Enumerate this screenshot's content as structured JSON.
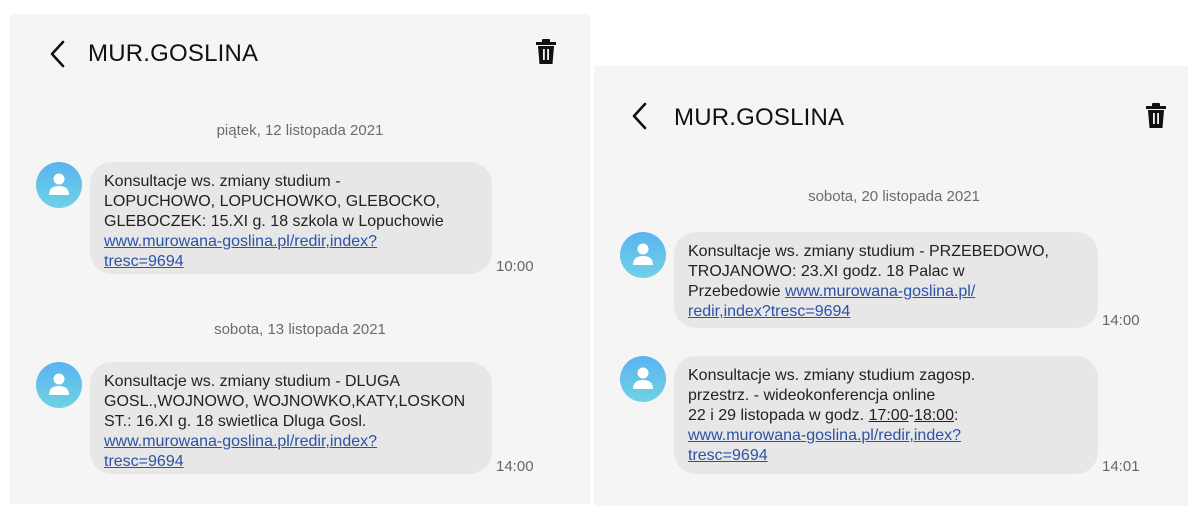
{
  "left": {
    "title": "MUR.GOSLINA",
    "dates": [
      "piątek, 12 listopada 2021",
      "sobota, 13 listopada 2021"
    ],
    "messages": [
      {
        "lines": [
          "Konsultacje ws. zmiany studium -",
          "LOPUCHOWO, LOPUCHOWKO, GLEBOCKO,",
          "GLEBOCZEK: 15.XI g. 18 szkola w Lopuchowie"
        ],
        "link_lines": [
          "www.murowana-goslina.pl/redir,index?",
          "tresc=9694"
        ],
        "time": "10:00"
      },
      {
        "lines": [
          "Konsultacje ws. zmiany studium - DLUGA",
          "GOSL.,WOJNOWO, WOJNOWKO,KATY,LOSKON",
          "ST.: 16.XI g. 18 swietlica Dluga Gosl."
        ],
        "link_lines": [
          "www.murowana-goslina.pl/redir,index?",
          "tresc=9694"
        ],
        "time": "14:00"
      }
    ]
  },
  "right": {
    "title": "MUR.GOSLINA",
    "date": "sobota, 20 listopada 2021",
    "messages": [
      {
        "line1": "Konsultacje ws. zmiany studium - PRZEBEDOWO,",
        "line2": "TROJANOWO: 23.XI godz. 18 Palac w",
        "line3_text": "Przebedowie ",
        "line3_link": "www.murowana-goslina.pl/",
        "line4_link": "redir,index?tresc=9694",
        "time": "14:00"
      },
      {
        "line1": "Konsultacje ws. zmiany studium zagosp.",
        "line2": "przestrz. - wideokonferencja online",
        "line3_pre": "22 i 29 listopada w godz. ",
        "line3_t1": "17:00",
        "line3_dash": "-",
        "line3_t2": "18:00",
        "line3_post": ":",
        "link_lines": [
          "www.murowana-goslina.pl/redir,index?",
          "tresc=9694"
        ],
        "time": "14:01"
      }
    ]
  }
}
